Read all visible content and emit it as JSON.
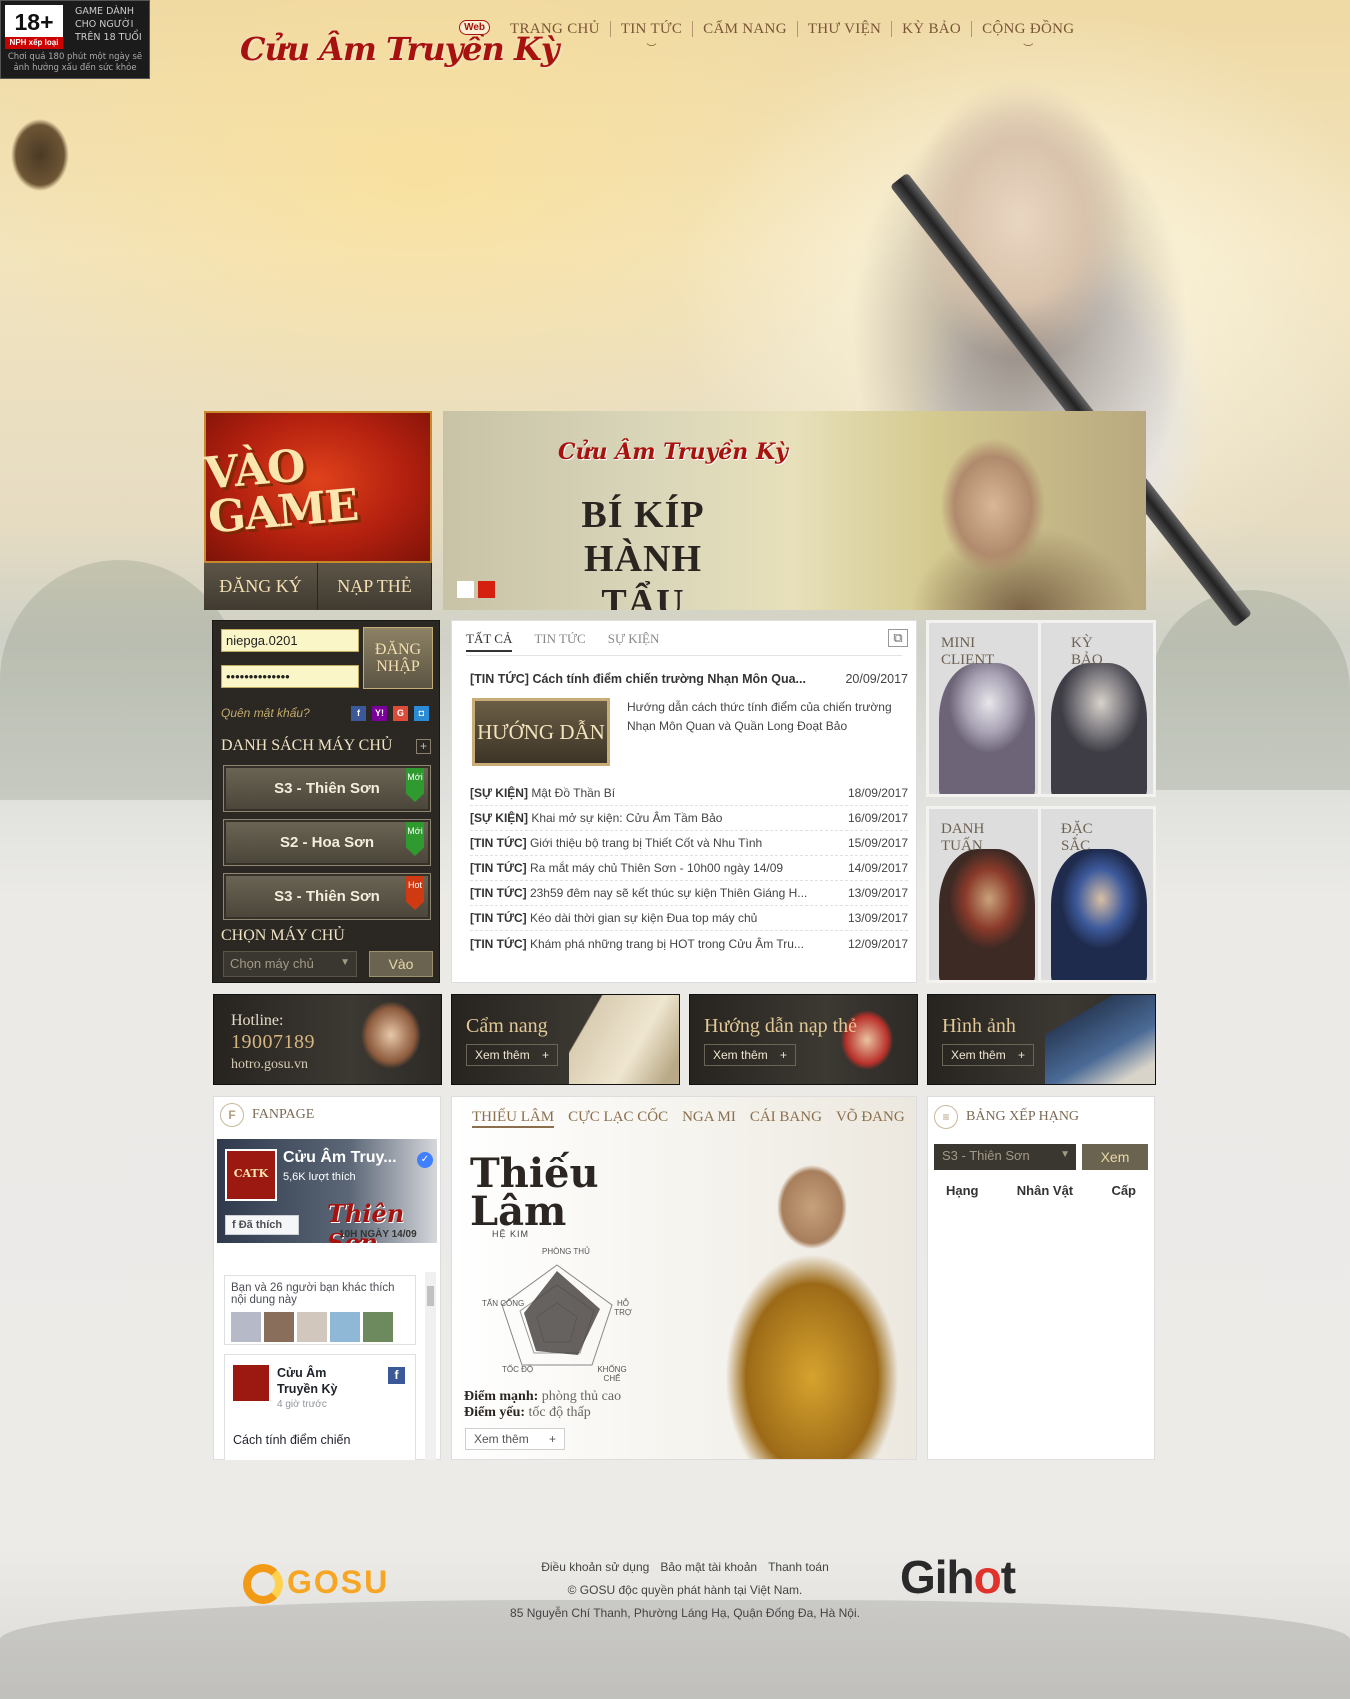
{
  "age_badge": {
    "rating": "18+",
    "label": "NPH xếp loại",
    "text": "GAME DÀNH CHO NGƯỜI TRÊN 18 TUỔI",
    "warning": "Chơi quá 180 phút một ngày sẽ ảnh hưởng xấu đến sức khỏe"
  },
  "logo": {
    "text": "Cửu Âm Truyền Kỳ",
    "badge": "Web"
  },
  "nav": [
    "TRANG CHỦ",
    "TIN TỨC",
    "CẨM NANG",
    "THƯ VIỆN",
    "KỲ BẢO",
    "CỘNG ĐỒNG"
  ],
  "play": {
    "main": "VÀO GAME",
    "register": "ĐĂNG KÝ",
    "topup": "NẠP THẺ"
  },
  "banner": {
    "logo": "Cửu Âm Truyền Kỳ",
    "title_line1": "BÍ KÍP",
    "title_line2": "HÀNH TẨU"
  },
  "login": {
    "username": "niepga.0201",
    "password": "••••••••••••••",
    "login_button_line1": "ĐĂNG",
    "login_button_line2": "NHẬP",
    "forgot": "Quên mật khẩu?",
    "servers_title": "DANH SÁCH MÁY CHỦ",
    "servers": [
      {
        "name": "S3 - Thiên Sơn",
        "tag": "Mới",
        "tag_color": "#2f9a2f"
      },
      {
        "name": "S2 - Hoa Sơn",
        "tag": "Mới",
        "tag_color": "#2f9a2f"
      },
      {
        "name": "S3 - Thiên Sơn",
        "tag": "Hot",
        "tag_color": "#d03a12"
      }
    ],
    "choose_title": "CHỌN MÁY CHỦ",
    "choose_placeholder": "Chọn máy chủ",
    "go_button": "Vào"
  },
  "news": {
    "tabs": [
      "TẤT CẢ",
      "TIN TỨC",
      "SỰ KIỆN"
    ],
    "headline": {
      "category": "[TIN TỨC]",
      "title": "Cách tính điểm chiến trường Nhạn Môn Qua...",
      "date": "20/09/2017"
    },
    "thumb_label": "HƯỚNG DẪN",
    "desc": "Hướng dẫn cách thức tính điểm của chiến trường Nhạn Môn Quan và Quần Long Đoạt Bảo",
    "items": [
      {
        "category": "[SỰ KIỆN]",
        "title": "Mật Đồ Thần Bí",
        "date": "18/09/2017"
      },
      {
        "category": "[SỰ KIỆN]",
        "title": "Khai mở sự kiện: Cửu Âm Tầm Bảo",
        "date": "16/09/2017"
      },
      {
        "category": "[TIN TỨC]",
        "title": "Giới thiệu bộ trang bị Thiết Cốt và Nhu Tình",
        "date": "15/09/2017"
      },
      {
        "category": "[TIN TỨC]",
        "title": "Ra mắt máy chủ Thiên Sơn - 10h00 ngày 14/09",
        "date": "14/09/2017"
      },
      {
        "category": "[TIN TỨC]",
        "title": "23h59 đêm nay sẽ kết thúc sự kiện Thiên Giáng H...",
        "date": "13/09/2017"
      },
      {
        "category": "[TIN TỨC]",
        "title": "Kéo dài thời gian sự kiện Đua top máy chủ",
        "date": "13/09/2017"
      },
      {
        "category": "[TIN TỨC]",
        "title": "Khám phá những trang bị HOT trong Cửu Âm Tru...",
        "date": "12/09/2017"
      }
    ]
  },
  "tiles": [
    {
      "line1": "MINI",
      "line2": "CLIENT"
    },
    {
      "line1": "KỲ",
      "line2": "BẢO"
    },
    {
      "line1": "DANH",
      "line2": "TUẤN"
    },
    {
      "line1": "ĐẶC",
      "line2": "SẮC"
    }
  ],
  "hotline": {
    "label": "Hotline:",
    "number": "19007189",
    "site": "hotro.gosu.vn"
  },
  "promos": [
    {
      "title": "Cẩm nang",
      "more": "Xem thêm"
    },
    {
      "title": "Hướng dẫn nạp thẻ",
      "more": "Xem thêm"
    },
    {
      "title": "Hình ảnh",
      "more": "Xem thêm"
    }
  ],
  "fanpage": {
    "title": "FANPAGE",
    "page_name": "Cửu Âm Truy...",
    "likes": "5,6K lượt thích",
    "cover_text": "Thiên Sơn",
    "cover_date": "10H NGÀY 14/09",
    "liked": "Đã thích",
    "friends": "Bạn và 26 người bạn khác thích nội dung này",
    "post_author": "Cửu Âm Truyền Kỳ",
    "post_time": "4 giờ trước",
    "post_text": "Cách tính điểm chiến"
  },
  "classes": {
    "tabs": [
      "THIẾU LÂM",
      "CỰC LẠC CỐC",
      "NGA MI",
      "CÁI BANG",
      "VÕ ĐANG"
    ],
    "name": "Thiếu Lâm",
    "element": "HỆ KIM",
    "stats": [
      "PHÒNG THỦ",
      "HỖ TRỢ",
      "KHỐNG CHẾ",
      "TỐC ĐỘ",
      "TẤN CÔNG"
    ],
    "strength_label": "Điểm mạnh:",
    "strength": "phòng thủ cao",
    "weakness_label": "Điểm yếu:",
    "weakness": "tốc độ thấp",
    "more": "Xem thêm"
  },
  "ranking": {
    "title": "BẢNG XẾP HẠNG",
    "server": "S3 - Thiên Sơn",
    "button": "Xem",
    "columns": [
      "Hạng",
      "Nhân Vật",
      "Cấp"
    ]
  },
  "footer": {
    "links": [
      "Điều khoản sử dụng",
      "Bảo mật tài khoản",
      "Thanh toán"
    ],
    "copyright": "© GOSU độc quyền phát hành tại Việt Nam.",
    "address": "85 Nguyễn Chí Thanh, Phường Láng Hạ, Quận Đống Đa, Hà Nội.",
    "gosu": "GOSU",
    "gihot_a": "Gih",
    "gihot_b": "o",
    "gihot_c": "t"
  }
}
